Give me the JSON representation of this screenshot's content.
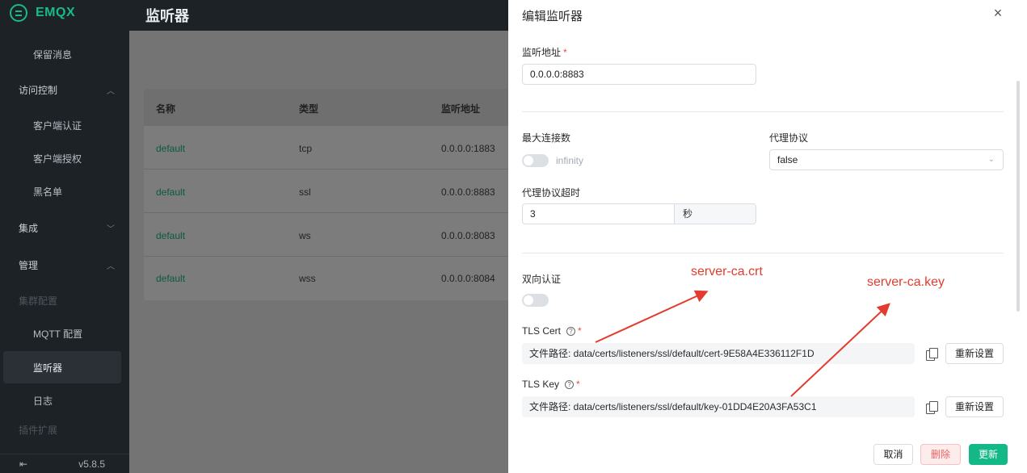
{
  "sidebar": {
    "brand": "EMQX",
    "items": [
      {
        "label": "保留消息",
        "kind": "child"
      },
      {
        "label": "访问控制",
        "kind": "group",
        "chevron": "up"
      },
      {
        "label": "客户端认证",
        "kind": "child"
      },
      {
        "label": "客户端授权",
        "kind": "child"
      },
      {
        "label": "黑名单",
        "kind": "child"
      },
      {
        "label": "集成",
        "kind": "group",
        "chevron": "down"
      },
      {
        "label": "管理",
        "kind": "group",
        "chevron": "up"
      },
      {
        "label": "集群配置",
        "kind": "disabled"
      },
      {
        "label": "MQTT 配置",
        "kind": "child"
      },
      {
        "label": "监听器",
        "kind": "active"
      },
      {
        "label": "日志",
        "kind": "child"
      },
      {
        "label": "插件扩展",
        "kind": "disabled"
      }
    ],
    "footer": {
      "collapse_glyph": "⇤",
      "version": "v5.8.5"
    }
  },
  "header": {
    "title": "监听器"
  },
  "table": {
    "columns": [
      "名称",
      "类型",
      "监听地址"
    ],
    "rows": [
      {
        "name": "default",
        "type": "tcp",
        "address": "0.0.0.0:1883"
      },
      {
        "name": "default",
        "type": "ssl",
        "address": "0.0.0.0:8883"
      },
      {
        "name": "default",
        "type": "ws",
        "address": "0.0.0.0:8083"
      },
      {
        "name": "default",
        "type": "wss",
        "address": "0.0.0.0:8084"
      }
    ]
  },
  "drawer": {
    "title": "编辑监听器",
    "bind_label": "监听地址",
    "bind_value": "0.0.0.0:8883",
    "max_conn_label": "最大连接数",
    "max_conn_hint": "infinity",
    "proxy_label": "代理协议",
    "proxy_value": "false",
    "proxy_timeout_label": "代理协议超时",
    "proxy_timeout_value": "3",
    "proxy_timeout_unit": "秒",
    "mutual_auth_label": "双向认证",
    "tls_cert_label": "TLS Cert",
    "tls_cert_value": "文件路径: data/certs/listeners/ssl/default/cert-9E58A4E336112F1D",
    "tls_key_label": "TLS Key",
    "tls_key_value": "文件路径: data/certs/listeners/ssl/default/key-01DD4E20A3FA53C1",
    "reset_label": "重新设置",
    "required_mark": "*",
    "help_mark": "?",
    "close_glyph": "×",
    "select_caret": "⌄",
    "buttons": {
      "cancel": "取消",
      "delete": "删除",
      "update": "更新"
    }
  },
  "annotations": {
    "cert": "server-ca.crt",
    "key": "server-ca.key",
    "color": "#e33b2e"
  },
  "colors": {
    "accent": "#12b886",
    "sidebar_bg": "#1d2227"
  }
}
